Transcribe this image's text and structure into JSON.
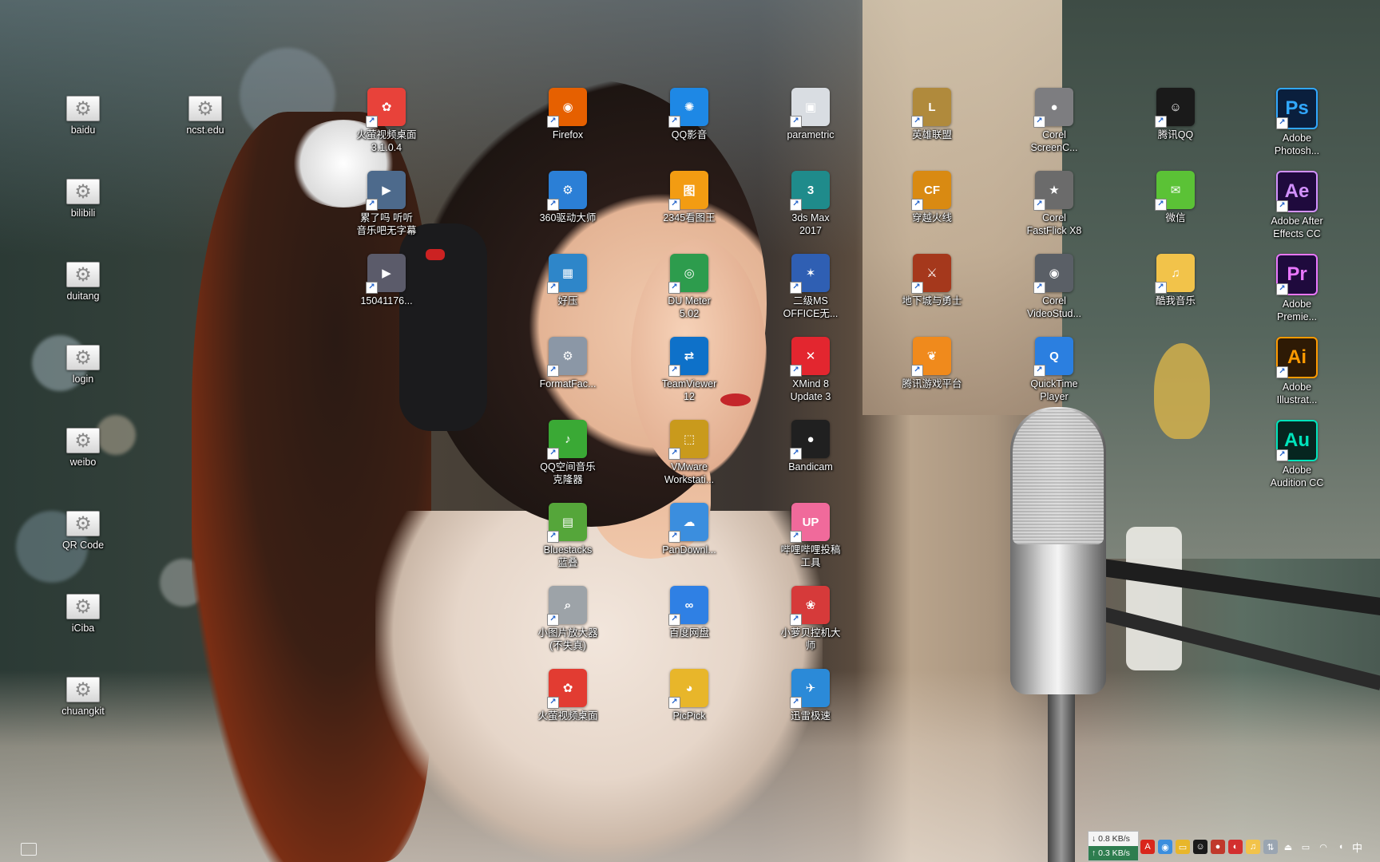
{
  "desktop": {
    "icons": [
      {
        "label": "baidu",
        "kind": "url",
        "icon": "url-shortcut-icon"
      },
      {
        "label": "bilibili",
        "kind": "url",
        "icon": "url-shortcut-icon"
      },
      {
        "label": "duitang",
        "kind": "url",
        "icon": "url-shortcut-icon"
      },
      {
        "label": "login",
        "kind": "url",
        "icon": "url-shortcut-icon"
      },
      {
        "label": "weibo",
        "kind": "url",
        "icon": "url-shortcut-icon"
      },
      {
        "label": "QR Code",
        "kind": "url",
        "icon": "url-shortcut-icon"
      },
      {
        "label": "iCiba",
        "kind": "url",
        "icon": "url-shortcut-icon"
      },
      {
        "label": "chuangkit",
        "kind": "url",
        "icon": "url-shortcut-icon"
      },
      {
        "label": "ncst.edu",
        "kind": "url",
        "icon": "url-shortcut-icon"
      },
      {
        "label": "火萤视频桌面\n3.1.0.4",
        "kind": "app",
        "icon": "huoying-icon",
        "color": "#e8423a",
        "glyph": "✿"
      },
      {
        "label": "累了吗 听听\n音乐吧无字幕",
        "kind": "app",
        "icon": "video-file-icon",
        "color": "#4d6a8c",
        "glyph": "▶"
      },
      {
        "label": "15041176...",
        "kind": "app",
        "icon": "video-file-icon",
        "color": "#5b5b6a",
        "glyph": "▶"
      },
      {
        "label": "Firefox",
        "kind": "app",
        "icon": "firefox-icon",
        "color": "#e66000",
        "glyph": "◉"
      },
      {
        "label": "360驱动大师",
        "kind": "app",
        "icon": "360-driver-icon",
        "color": "#2b7fd6",
        "glyph": "⚙"
      },
      {
        "label": "好压",
        "kind": "app",
        "icon": "haozip-icon",
        "color": "#2e86c9",
        "glyph": "▦"
      },
      {
        "label": "FormatFac...",
        "kind": "app",
        "icon": "formatfactory-icon",
        "color": "#8b97a6",
        "glyph": "⚙"
      },
      {
        "label": "QQ空间音乐\n克隆器",
        "kind": "app",
        "icon": "qzone-music-icon",
        "color": "#3aa935",
        "glyph": "♪"
      },
      {
        "label": "Bluestacks\n蓝叠",
        "kind": "app",
        "icon": "bluestacks-icon",
        "color": "#55a63a",
        "glyph": "▤"
      },
      {
        "label": "小图片放大器\n(不失真)",
        "kind": "app",
        "icon": "image-enlarger-icon",
        "color": "#9da3a8",
        "glyph": "⌕"
      },
      {
        "label": "火萤视频桌面",
        "kind": "app",
        "icon": "huoying-icon",
        "color": "#e23c32",
        "glyph": "✿"
      },
      {
        "label": "QQ影音",
        "kind": "app",
        "icon": "qq-player-icon",
        "color": "#1e88e5",
        "glyph": "✺"
      },
      {
        "label": "2345看图王",
        "kind": "app",
        "icon": "2345-viewer-icon",
        "color": "#f39c12",
        "glyph": "图"
      },
      {
        "label": "DU Meter\n5.02",
        "kind": "app",
        "icon": "du-meter-icon",
        "color": "#2d9c4d",
        "glyph": "◎"
      },
      {
        "label": "TeamViewer\n12",
        "kind": "app",
        "icon": "teamviewer-icon",
        "color": "#0e71c9",
        "glyph": "⇄"
      },
      {
        "label": "VMware\nWorkstati...",
        "kind": "app",
        "icon": "vmware-icon",
        "color": "#c99a1c",
        "glyph": "⬚"
      },
      {
        "label": "PanDownl...",
        "kind": "app",
        "icon": "pandownload-icon",
        "color": "#3b8ede",
        "glyph": "☁"
      },
      {
        "label": "百度网盘",
        "kind": "app",
        "icon": "baidu-netdisk-icon",
        "color": "#2f80e4",
        "glyph": "∞"
      },
      {
        "label": "PicPick",
        "kind": "app",
        "icon": "picpick-icon",
        "color": "#e8b62a",
        "glyph": "◕"
      },
      {
        "label": "parametric",
        "kind": "app",
        "icon": "parametric-icon",
        "color": "#d9dde2",
        "glyph": "▣"
      },
      {
        "label": "3ds Max\n2017",
        "kind": "app",
        "icon": "3dsmax-icon",
        "color": "#1f8b8b",
        "glyph": "3"
      },
      {
        "label": "二级MS\nOFFICE无...",
        "kind": "app",
        "icon": "ms-office-exam-icon",
        "color": "#2f5fb3",
        "glyph": "✶"
      },
      {
        "label": "XMind 8\nUpdate 3",
        "kind": "app",
        "icon": "xmind-icon",
        "color": "#e3262f",
        "glyph": "✕"
      },
      {
        "label": "Bandicam",
        "kind": "app",
        "icon": "bandicam-icon",
        "color": "#202020",
        "glyph": "●"
      },
      {
        "label": "哔哩哔哩投稿\n工具",
        "kind": "app",
        "icon": "bilibili-upload-icon",
        "color": "#f06a9b",
        "glyph": "UP"
      },
      {
        "label": "小萝贝控机大\n师",
        "kind": "app",
        "icon": "xiaoluobei-icon",
        "color": "#d63a3a",
        "glyph": "❀"
      },
      {
        "label": "迅雷极速",
        "kind": "app",
        "icon": "xunlei-icon",
        "color": "#2b8ad8",
        "glyph": "✈"
      },
      {
        "label": "英雄联盟",
        "kind": "app",
        "icon": "lol-icon",
        "color": "#b08a3c",
        "glyph": "L"
      },
      {
        "label": "穿越火线",
        "kind": "app",
        "icon": "crossfire-icon",
        "color": "#d98a12",
        "glyph": "CF"
      },
      {
        "label": "地下城与勇士",
        "kind": "app",
        "icon": "dnf-icon",
        "color": "#a5381c",
        "glyph": "⚔"
      },
      {
        "label": "腾讯游戏平台",
        "kind": "app",
        "icon": "tencent-game-icon",
        "color": "#f08a1c",
        "glyph": "❦"
      },
      {
        "label": "Corel\nScreenC...",
        "kind": "app",
        "icon": "corel-screencap-icon",
        "color": "#7d7d80",
        "glyph": "●"
      },
      {
        "label": "Corel\nFastFlick X8",
        "kind": "app",
        "icon": "corel-fastflick-icon",
        "color": "#6b6b6b",
        "glyph": "★"
      },
      {
        "label": "Corel\nVideoStud...",
        "kind": "app",
        "icon": "corel-videostudio-icon",
        "color": "#5a5f66",
        "glyph": "◉"
      },
      {
        "label": "QuickTime\nPlayer",
        "kind": "app",
        "icon": "quicktime-icon",
        "color": "#2b7fe0",
        "glyph": "Q"
      },
      {
        "label": "腾讯QQ",
        "kind": "app",
        "icon": "qq-icon",
        "color": "#1a1a1a",
        "glyph": "☺"
      },
      {
        "label": "微信",
        "kind": "app",
        "icon": "wechat-icon",
        "color": "#5bc236",
        "glyph": "✉"
      },
      {
        "label": "酷我音乐",
        "kind": "app",
        "icon": "kuwo-icon",
        "color": "#f2c34a",
        "glyph": "♫"
      },
      {
        "label": "Adobe\nPhotosh...",
        "kind": "app",
        "icon": "photoshop-icon",
        "color": "#0a1f3d",
        "glyph": "Ps",
        "fg": "#31a8ff"
      },
      {
        "label": "Adobe After\nEffects CC",
        "kind": "app",
        "icon": "after-effects-icon",
        "color": "#1f0a3d",
        "glyph": "Ae",
        "fg": "#d291ff"
      },
      {
        "label": "Adobe\nPremie...",
        "kind": "app",
        "icon": "premiere-icon",
        "color": "#1f0a3d",
        "glyph": "Pr",
        "fg": "#ea77ff"
      },
      {
        "label": "Adobe\nIllustrat...",
        "kind": "app",
        "icon": "illustrator-icon",
        "color": "#2e1a05",
        "glyph": "Ai",
        "fg": "#ff9a00"
      },
      {
        "label": "Adobe\nAudition CC",
        "kind": "app",
        "icon": "audition-icon",
        "color": "#06251f",
        "glyph": "Au",
        "fg": "#00e4bb"
      }
    ]
  },
  "taskbar": {
    "net_down": "0.8 KB/s",
    "net_up": "0.3 KB/s",
    "ime": "中",
    "tray_icons": [
      "acrobat-icon",
      "chrome-icon",
      "folder-icon",
      "qq-tray-icon",
      "record-icon",
      "netease-music-icon",
      "kuwo-tray-icon",
      "network-flow-icon",
      "usb-icon",
      "battery-icon",
      "wifi-icon",
      "volume-icon"
    ]
  }
}
